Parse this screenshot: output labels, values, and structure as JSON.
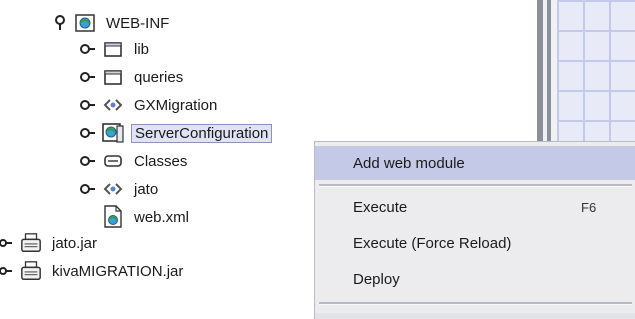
{
  "tree": {
    "items": [
      {
        "label": "WEB-INF"
      },
      {
        "label": "lib"
      },
      {
        "label": "queries"
      },
      {
        "label": "GXMigration"
      },
      {
        "label": "ServerConfiguration"
      },
      {
        "label": "Classes"
      },
      {
        "label": "jato"
      },
      {
        "label": "web.xml"
      },
      {
        "label": "jato.jar"
      },
      {
        "label": "kivaMIGRATION.jar"
      }
    ]
  },
  "context_menu": {
    "items": [
      {
        "label": "Add web module"
      },
      {
        "label": "Execute",
        "shortcut": "F6"
      },
      {
        "label": "Execute (Force Reload)"
      },
      {
        "label": "Deploy"
      }
    ]
  },
  "colors": {
    "selection": "#dfe3f4",
    "menu_highlight": "#c4c9e7",
    "menu_background": "#ececef"
  }
}
